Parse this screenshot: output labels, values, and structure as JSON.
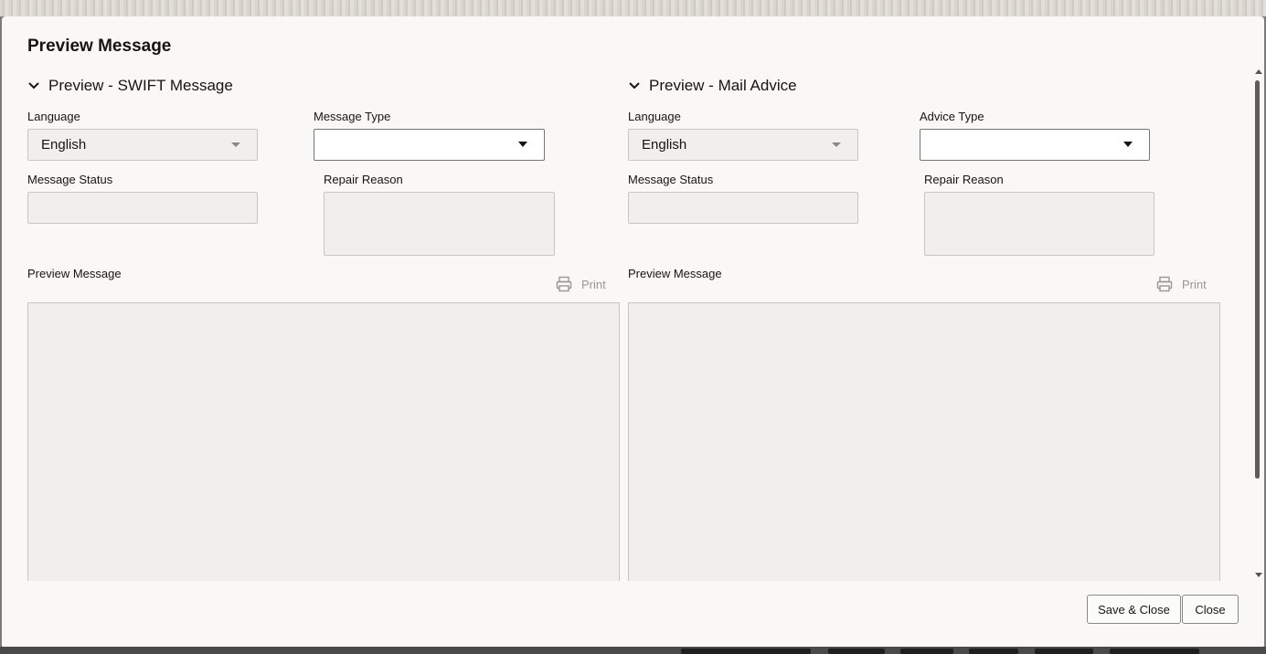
{
  "dialog": {
    "title": "Preview Message"
  },
  "swift": {
    "section_title": "Preview - SWIFT Message",
    "language_label": "Language",
    "language_value": "English",
    "message_type_label": "Message Type",
    "message_type_value": "",
    "message_status_label": "Message Status",
    "message_status_value": "",
    "repair_reason_label": "Repair Reason",
    "repair_reason_value": "",
    "preview_label": "Preview Message",
    "print_label": "Print",
    "preview_content": ""
  },
  "mail": {
    "section_title": "Preview - Mail Advice",
    "language_label": "Language",
    "language_value": "English",
    "advice_type_label": "Advice Type",
    "advice_type_value": "",
    "message_status_label": "Message Status",
    "message_status_value": "",
    "repair_reason_label": "Repair Reason",
    "repair_reason_value": "",
    "preview_label": "Preview Message",
    "print_label": "Print",
    "preview_content": ""
  },
  "footer": {
    "save_close_label": "Save & Close",
    "close_label": "Close"
  },
  "icons": {
    "section_toggle": "chevron-down-icon",
    "print": "printer-icon",
    "dropdown": "caret-down-icon"
  }
}
